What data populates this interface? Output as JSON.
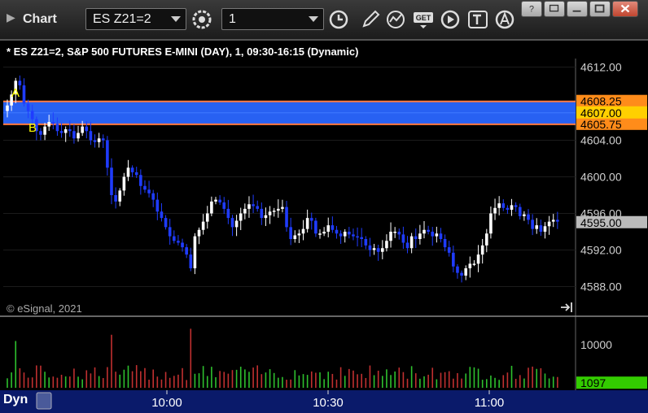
{
  "window": {
    "title": "Chart",
    "symbol_value": "ES Z21=2",
    "interval_value": "1",
    "get_label": "GET"
  },
  "chart": {
    "legend": "* ES Z21=2, S&P 500 FUTURES E-MINI (DAY), 1, 09:30-16:15 (Dynamic)",
    "copyright": "© eSignal, 2021",
    "mode_label": "Dyn",
    "price_ticks": [
      "4612.00",
      "4604.00",
      "4600.00",
      "4596.00",
      "4592.00",
      "4588.00"
    ],
    "price_tick_values": [
      4612,
      4604,
      4600,
      4596,
      4592,
      4588
    ],
    "volume_ticks": [
      "10000"
    ],
    "volume_tick_values": [
      10000
    ],
    "time_ticks": [
      "10:00",
      "10:30",
      "11:00"
    ],
    "time_tick_minutes": [
      30,
      60,
      90
    ],
    "level_labels": {
      "upper": "4608.25",
      "mid": "4607.00",
      "lower": "4605.75",
      "last": "4595.00",
      "volume": "1097"
    },
    "level_values": {
      "upper": 4608.25,
      "mid": 4607.0,
      "lower": 4605.75,
      "last": 4595.0,
      "volume": 1097
    },
    "markers": [
      "A",
      "B"
    ],
    "colors": {
      "up": "#ffffff",
      "down": "#1f3cff",
      "zone": "#2a66ff",
      "zone_line": "#ff7a40",
      "upper_tag": "#ff8c1a",
      "mid_tag": "#ffd000",
      "last_tag": "#bbbbbb",
      "vol_up": "#2ec02e",
      "vol_down": "#c03030",
      "vol_tag": "#33cc00",
      "marker": "#ffff00"
    }
  }
}
